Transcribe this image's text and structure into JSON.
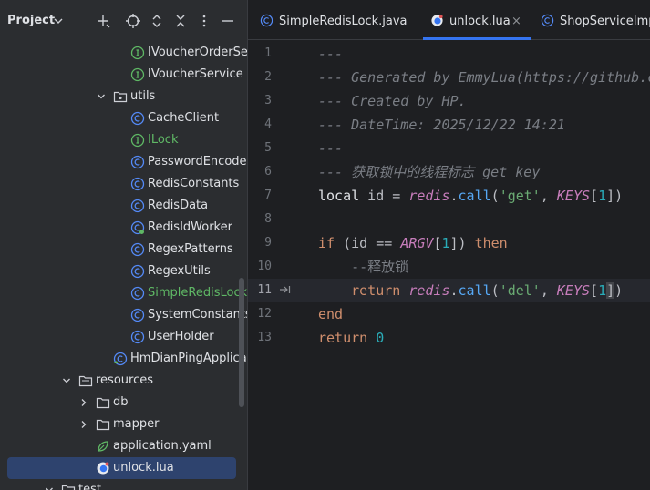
{
  "project_panel": {
    "title": "Project",
    "tree": [
      {
        "label": "IVoucherOrderServ",
        "icon": "interface-icon",
        "color": "normal"
      },
      {
        "label": "IVoucherService",
        "icon": "interface-icon",
        "color": "normal"
      },
      {
        "label": "utils",
        "icon": "package-icon",
        "color": "normal"
      },
      {
        "label": "CacheClient",
        "icon": "class-icon",
        "color": "normal"
      },
      {
        "label": "ILock",
        "icon": "interface-icon",
        "color": "green"
      },
      {
        "label": "PasswordEncoder",
        "icon": "class-icon",
        "color": "normal"
      },
      {
        "label": "RedisConstants",
        "icon": "class-icon",
        "color": "normal"
      },
      {
        "label": "RedisData",
        "icon": "class-icon",
        "color": "normal"
      },
      {
        "label": "RedisIdWorker",
        "icon": "class-icon",
        "color": "normal"
      },
      {
        "label": "RegexPatterns",
        "icon": "class-icon",
        "color": "normal"
      },
      {
        "label": "RegexUtils",
        "icon": "class-icon",
        "color": "normal"
      },
      {
        "label": "SimpleRedisLock",
        "icon": "class-icon",
        "color": "green"
      },
      {
        "label": "SystemConstants",
        "icon": "class-icon",
        "color": "normal"
      },
      {
        "label": "UserHolder",
        "icon": "class-icon",
        "color": "normal"
      },
      {
        "label": "HmDianPingApplicatio",
        "icon": "spring-boot-class-icon",
        "color": "normal"
      },
      {
        "label": "resources",
        "icon": "resources-folder-icon",
        "color": "normal"
      },
      {
        "label": "db",
        "icon": "folder-icon",
        "color": "normal"
      },
      {
        "label": "mapper",
        "icon": "folder-icon",
        "color": "normal"
      },
      {
        "label": "application.yaml",
        "icon": "spring-config-icon",
        "color": "normal"
      },
      {
        "label": "unlock.lua",
        "icon": "lua-file-icon",
        "color": "normal"
      },
      {
        "label": "test",
        "icon": "folder-icon",
        "color": "normal"
      }
    ]
  },
  "editor": {
    "tabs": [
      {
        "label": "SimpleRedisLock.java",
        "icon": "class-icon"
      },
      {
        "label": "unlock.lua",
        "icon": "lua-file-icon",
        "close": "×"
      },
      {
        "label": "ShopServiceImpl.j",
        "icon": "class-icon"
      }
    ],
    "line_numbers": [
      "1",
      "2",
      "3",
      "4",
      "5",
      "6",
      "7",
      "8",
      "9",
      "10",
      "11",
      "12",
      "13"
    ],
    "current_line": 11,
    "code_lines": [
      [
        "---"
      ],
      [
        "--- Generated by EmmyLua(https://github.c"
      ],
      [
        "--- Created by HP."
      ],
      [
        "--- DateTime: 2025/12/22 14:21"
      ],
      [
        "---"
      ],
      [
        "--- 获取锁中的线程标志 get key"
      ],
      [
        "local",
        " id = ",
        "redis",
        ".",
        "call",
        "(",
        "'get'",
        ", ",
        "KEYS",
        "[",
        "1",
        "])"
      ],
      [
        ""
      ],
      [
        "if",
        " (id == ",
        "ARGV",
        "[",
        "1",
        "]) ",
        "then"
      ],
      [
        "    --释放锁"
      ],
      [
        "    ",
        "return",
        " ",
        "redis",
        ".",
        "call",
        "(",
        "'del'",
        ", ",
        "KEYS",
        "[",
        "1",
        "]",
        ")"
      ],
      [
        "end"
      ],
      [
        "return",
        " ",
        "0"
      ]
    ]
  },
  "colors": {
    "accent": "#3574f0",
    "comment": "#7a7e85",
    "keyword": "#cf8e6d",
    "string": "#6aab73",
    "number": "#2aacb8",
    "function": "#56a8f5",
    "global": "#c77dbb",
    "vcs_added": "#5fb865"
  }
}
